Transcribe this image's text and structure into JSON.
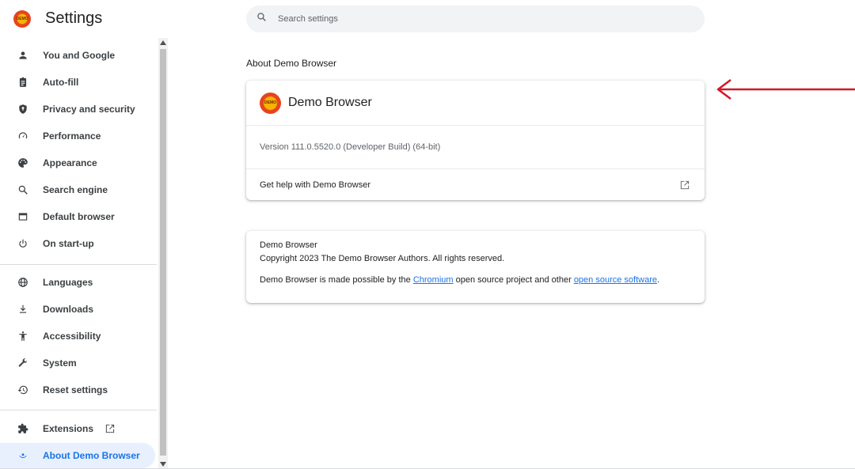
{
  "header": {
    "logo_text": "DEMO",
    "title": "Settings",
    "search_placeholder": "Search settings"
  },
  "sidebar": {
    "items": [
      {
        "label": "You and Google",
        "icon": "person-icon"
      },
      {
        "label": "Auto-fill",
        "icon": "clipboard-icon"
      },
      {
        "label": "Privacy and security",
        "icon": "shield-icon"
      },
      {
        "label": "Performance",
        "icon": "speedometer-icon"
      },
      {
        "label": "Appearance",
        "icon": "palette-icon"
      },
      {
        "label": "Search engine",
        "icon": "search-icon"
      },
      {
        "label": "Default browser",
        "icon": "browser-window-icon"
      },
      {
        "label": "On start-up",
        "icon": "power-icon"
      },
      {
        "label": "Languages",
        "icon": "globe-icon"
      },
      {
        "label": "Downloads",
        "icon": "download-icon"
      },
      {
        "label": "Accessibility",
        "icon": "accessibility-icon"
      },
      {
        "label": "System",
        "icon": "wrench-icon"
      },
      {
        "label": "Reset settings",
        "icon": "restore-icon"
      },
      {
        "label": "Extensions",
        "icon": "puzzle-icon"
      },
      {
        "label": "About Demo Browser",
        "icon": "browser-logo-icon"
      }
    ],
    "active_index": 14
  },
  "main": {
    "section_title": "About Demo Browser",
    "product_card": {
      "logo_text": "DEMO",
      "name": "Demo Browser",
      "version": "Version 111.0.5520.0 (Developer Build) (64-bit)",
      "help_label": "Get help with Demo Browser"
    },
    "legal_card": {
      "name": "Demo Browser",
      "copyright": "Copyright 2023 The Demo Browser Authors. All rights reserved.",
      "made_possible_prefix": "Demo Browser is made possible by the ",
      "chromium_link": "Chromium",
      "made_possible_middle": " open source project and other ",
      "oss_link": "open source software",
      "made_possible_suffix": "."
    }
  },
  "colors": {
    "accent": "#1a73e8",
    "active_bg": "#e8f0fe",
    "annotation_arrow": "#d0182a"
  }
}
